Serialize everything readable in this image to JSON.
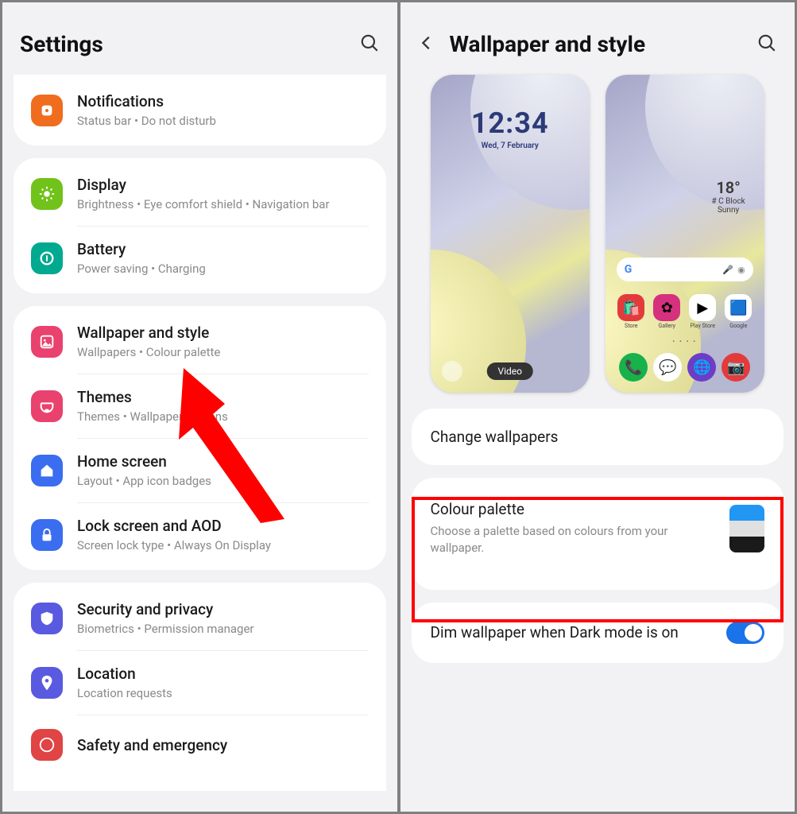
{
  "left": {
    "title": "Settings",
    "items": [
      {
        "title": "Notifications",
        "sub": "Status bar  •  Do not disturb"
      },
      {
        "title": "Display",
        "sub": "Brightness  •  Eye comfort shield  •  Navigation bar"
      },
      {
        "title": "Battery",
        "sub": "Power saving  •  Charging"
      },
      {
        "title": "Wallpaper and style",
        "sub": "Wallpapers  •  Colour palette"
      },
      {
        "title": "Themes",
        "sub": "Themes  •  Wallpapers  •  Icons"
      },
      {
        "title": "Home screen",
        "sub": "Layout  •  App icon badges"
      },
      {
        "title": "Lock screen and AOD",
        "sub": "Screen lock type  •  Always On Display"
      },
      {
        "title": "Security and privacy",
        "sub": "Biometrics  •  Permission manager"
      },
      {
        "title": "Location",
        "sub": "Location requests"
      },
      {
        "title": "Safety and emergency",
        "sub": ""
      }
    ]
  },
  "right": {
    "title": "Wallpaper and style",
    "lock_time": "12:34",
    "lock_date": "Wed, 7 February",
    "video_label": "Video",
    "weather_temp": "18°",
    "weather_loc": "# C Block",
    "weather_cond": "Sunny",
    "google_g": "G",
    "dock_apps": [
      "phone",
      "messages",
      "browser",
      "camera"
    ],
    "grid_apps": [
      "Store",
      "Gallery",
      "Play Store",
      "Google"
    ],
    "change_wallpapers": "Change wallpapers",
    "palette_title": "Colour palette",
    "palette_sub": "Choose a palette based on colours from your wallpaper.",
    "palette_colors": [
      "#2196f3",
      "#e0e0e0",
      "#1a1a1a"
    ],
    "dim_title": "Dim wallpaper when Dark mode is on",
    "dim_on": true
  }
}
